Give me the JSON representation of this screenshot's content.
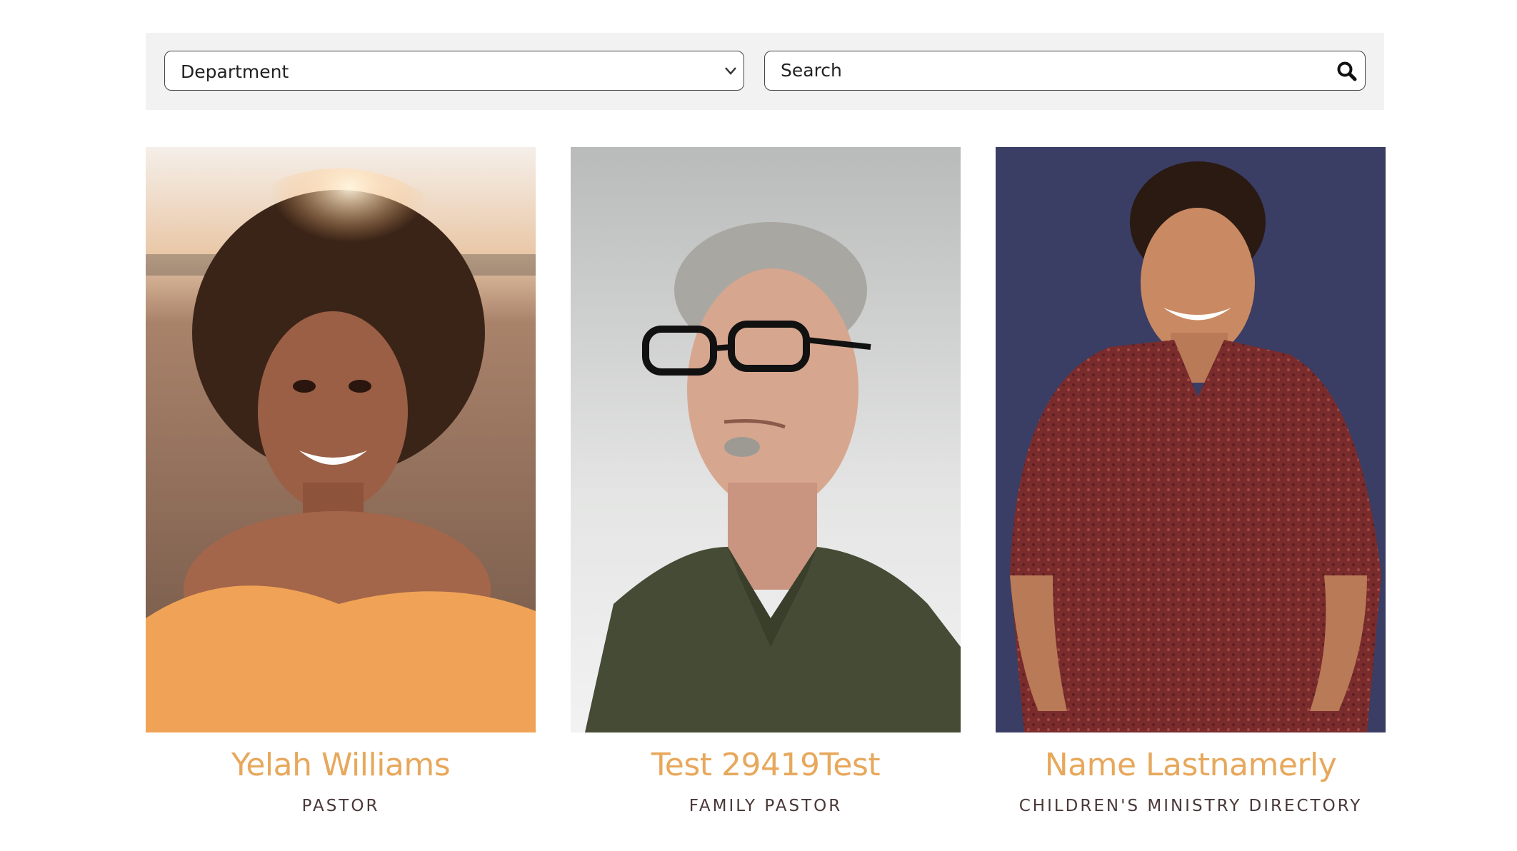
{
  "filters": {
    "department": {
      "selected": "Department",
      "icon": "chevron-down-icon"
    },
    "search": {
      "placeholder": "Search",
      "icon": "search-icon"
    }
  },
  "staff": [
    {
      "name": "Yelah Williams",
      "role": "PASTOR",
      "photo": "staff-photo-woman-curly-hair"
    },
    {
      "name": "Test 29419Test",
      "role": "FAMILY PASTOR",
      "photo": "staff-photo-man-glasses"
    },
    {
      "name": "Name Lastnamerly",
      "role": "CHILDREN'S MINISTRY DIRECTORY",
      "photo": "staff-photo-person-red-shirt"
    }
  ],
  "colors": {
    "name_accent": "#e7a85c",
    "role_text": "#4a3838",
    "filter_bar_bg": "#f2f2f2"
  }
}
